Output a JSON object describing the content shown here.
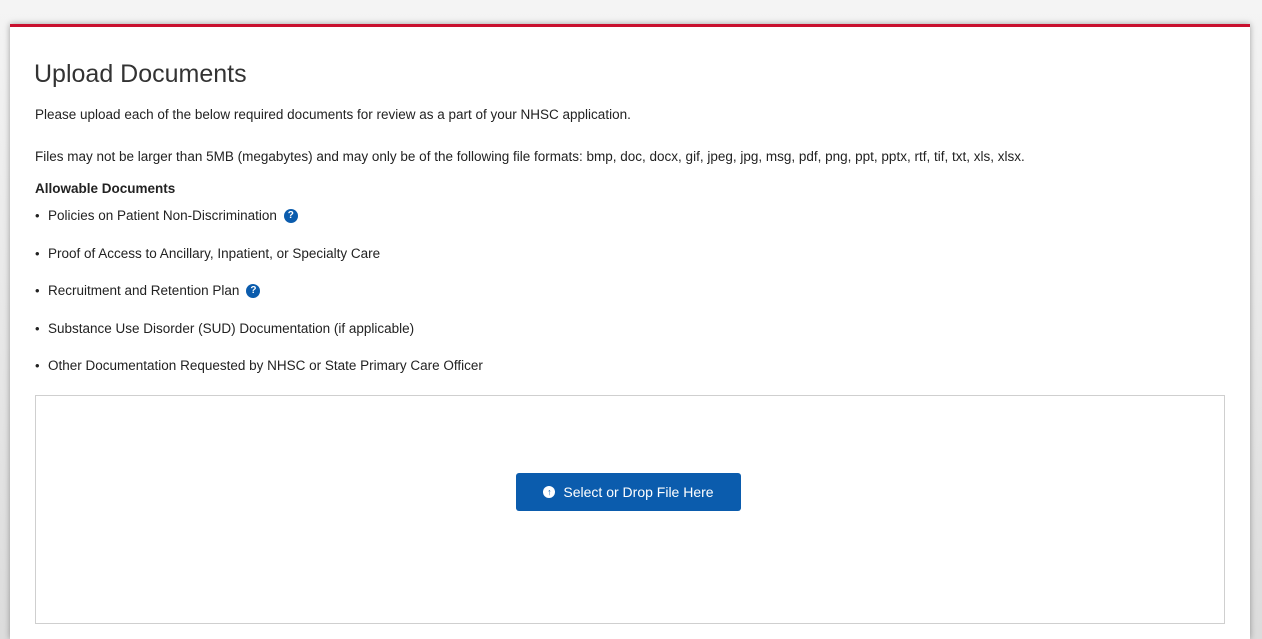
{
  "upload": {
    "title": "Upload Documents",
    "intro": "Please upload each of the below required documents for review as a part of your NHSC application.",
    "file_rules": "Files may not be larger than 5MB (megabytes) and may only be of the following file formats: bmp, doc, docx, gif, jpeg, jpg, msg, pdf, png, ppt, pptx, rtf, tif, txt, xls, xlsx.",
    "allowable_heading": "Allowable Documents",
    "documents": [
      {
        "label": "Policies on Patient Non-Discrimination",
        "help_icon": "question-circle-icon"
      },
      {
        "label": "Proof of Access to Ancillary, Inpatient, or Specialty Care"
      },
      {
        "label": "Recruitment and Retention Plan",
        "help_icon": "question-circle-icon"
      },
      {
        "label": "Substance Use Disorder (SUD) Documentation (if applicable)"
      },
      {
        "label": "Other Documentation Requested by NHSC or State Primary Care Officer"
      }
    ],
    "dropzone": {
      "button_label": "Select or Drop File Here",
      "button_icon": "upload-arrow-circle-icon"
    }
  },
  "colors": {
    "accent_top_border": "#c8102e",
    "primary_button": "#0b5cad",
    "help_icon": "#0b5cad"
  }
}
